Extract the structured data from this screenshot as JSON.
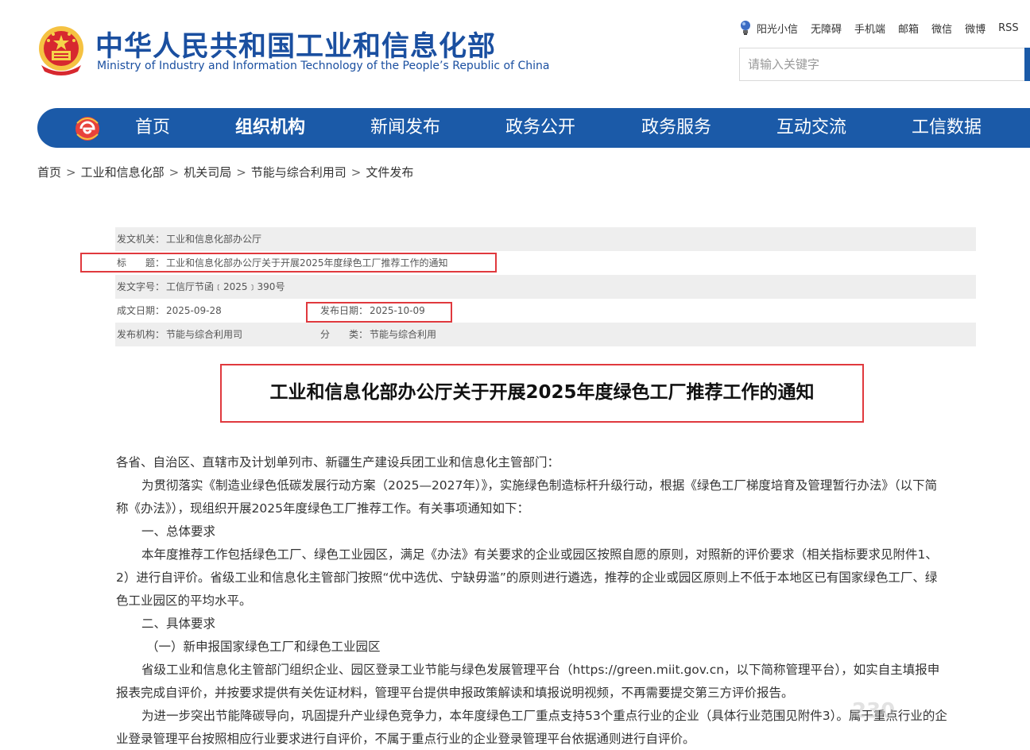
{
  "header": {
    "site_title": "中华人民共和国工业和信息化部",
    "site_subtitle": "Ministry of Industry and Information Technology of the People’s Republic of China",
    "top_links": [
      "阳光小信",
      "无障碍",
      "手机端",
      "邮箱",
      "微信",
      "微博",
      "RSS"
    ],
    "search_placeholder": "请输入关键字"
  },
  "nav": {
    "items": [
      "首页",
      "组织机构",
      "新闻发布",
      "政务公开",
      "政务服务",
      "互动交流",
      "工信数据"
    ],
    "active": "组织机构"
  },
  "breadcrumb": [
    "首页",
    "工业和信息化部",
    "机关司局",
    "节能与综合利用司",
    "文件发布"
  ],
  "breadcrumb_sep": ">",
  "meta": {
    "issuer_label": "发文机关：",
    "issuer": "工业和信息化部办公厅",
    "title_label": "标　　题：",
    "title": "工业和信息化部办公厅关于开展2025年度绿色工厂推荐工作的通知",
    "docno_label": "发文字号：",
    "docno": "工信厅节函﹝2025﹞390号",
    "date_label": "成文日期：",
    "date": "2025-09-28",
    "pubdate_label": "发布日期：",
    "pubdate": "2025-10-09",
    "org_label": "发布机构：",
    "org": "节能与综合利用司",
    "category_label": "分　　类：",
    "category": "节能与综合利用"
  },
  "doc_title": "工业和信息化部办公厅关于开展2025年度绿色工厂推荐工作的通知",
  "body": {
    "p1": "各省、自治区、直辖市及计划单列市、新疆生产建设兵团工业和信息化主管部门：",
    "p2a": "为贯彻落实《制造业绿色低碳发展行动方案（2025—2027年）》，实施绿色制造标杆升级行动，根据《绿色工厂梯度培育及管理暂行办法》（以下简",
    "p2b": "称《办法》），现组织开展2025年度绿色工厂推荐工作。有关事项通知如下：",
    "h1": "一、总体要求",
    "p3a": "本年度推荐工作包括绿色工厂、绿色工业园区，满足《办法》有关要求的企业或园区按照自愿的原则，对照新的评价要求（相关指标要求见附件1、",
    "p3b": "2）进行自评价。省级工业和信息化主管部门按照“优中选优、宁缺毋滥”的原则进行遴选，推荐的企业或园区原则上不低于本地区已有国家绿色工厂、绿",
    "p3c": "色工业园区的平均水平。",
    "h2": "二、具体要求",
    "h3": "（一）新申报国家绿色工厂和绿色工业园区",
    "p4a": "省级工业和信息化主管部门组织企业、园区登录工业节能与绿色发展管理平台（https://green.miit.gov.cn，以下简称管理平台），如实自主填报申",
    "p4b": "报表完成自评价，并按要求提供有关佐证材料，管理平台提供申报政策解读和填报说明视频，不再需要提交第三方评价报告。",
    "p5a": "为进一步突出节能降碳导向，巩固提升产业绿色竞争力，本年度绿色工厂重点支持53个重点行业的企业（具体行业范围见附件3）。属于重点行业的企",
    "p5b": "业登录管理平台按照相应行业要求进行自评价，不属于重点行业的企业登录管理平台依据通则进行自评价。"
  },
  "watermark": "230",
  "colors": {
    "nav_bg": "#1b5aa8",
    "title_blue": "#1a4fa0",
    "highlight_red": "#e0393e",
    "meta_row_bg": "#eeeeee"
  }
}
